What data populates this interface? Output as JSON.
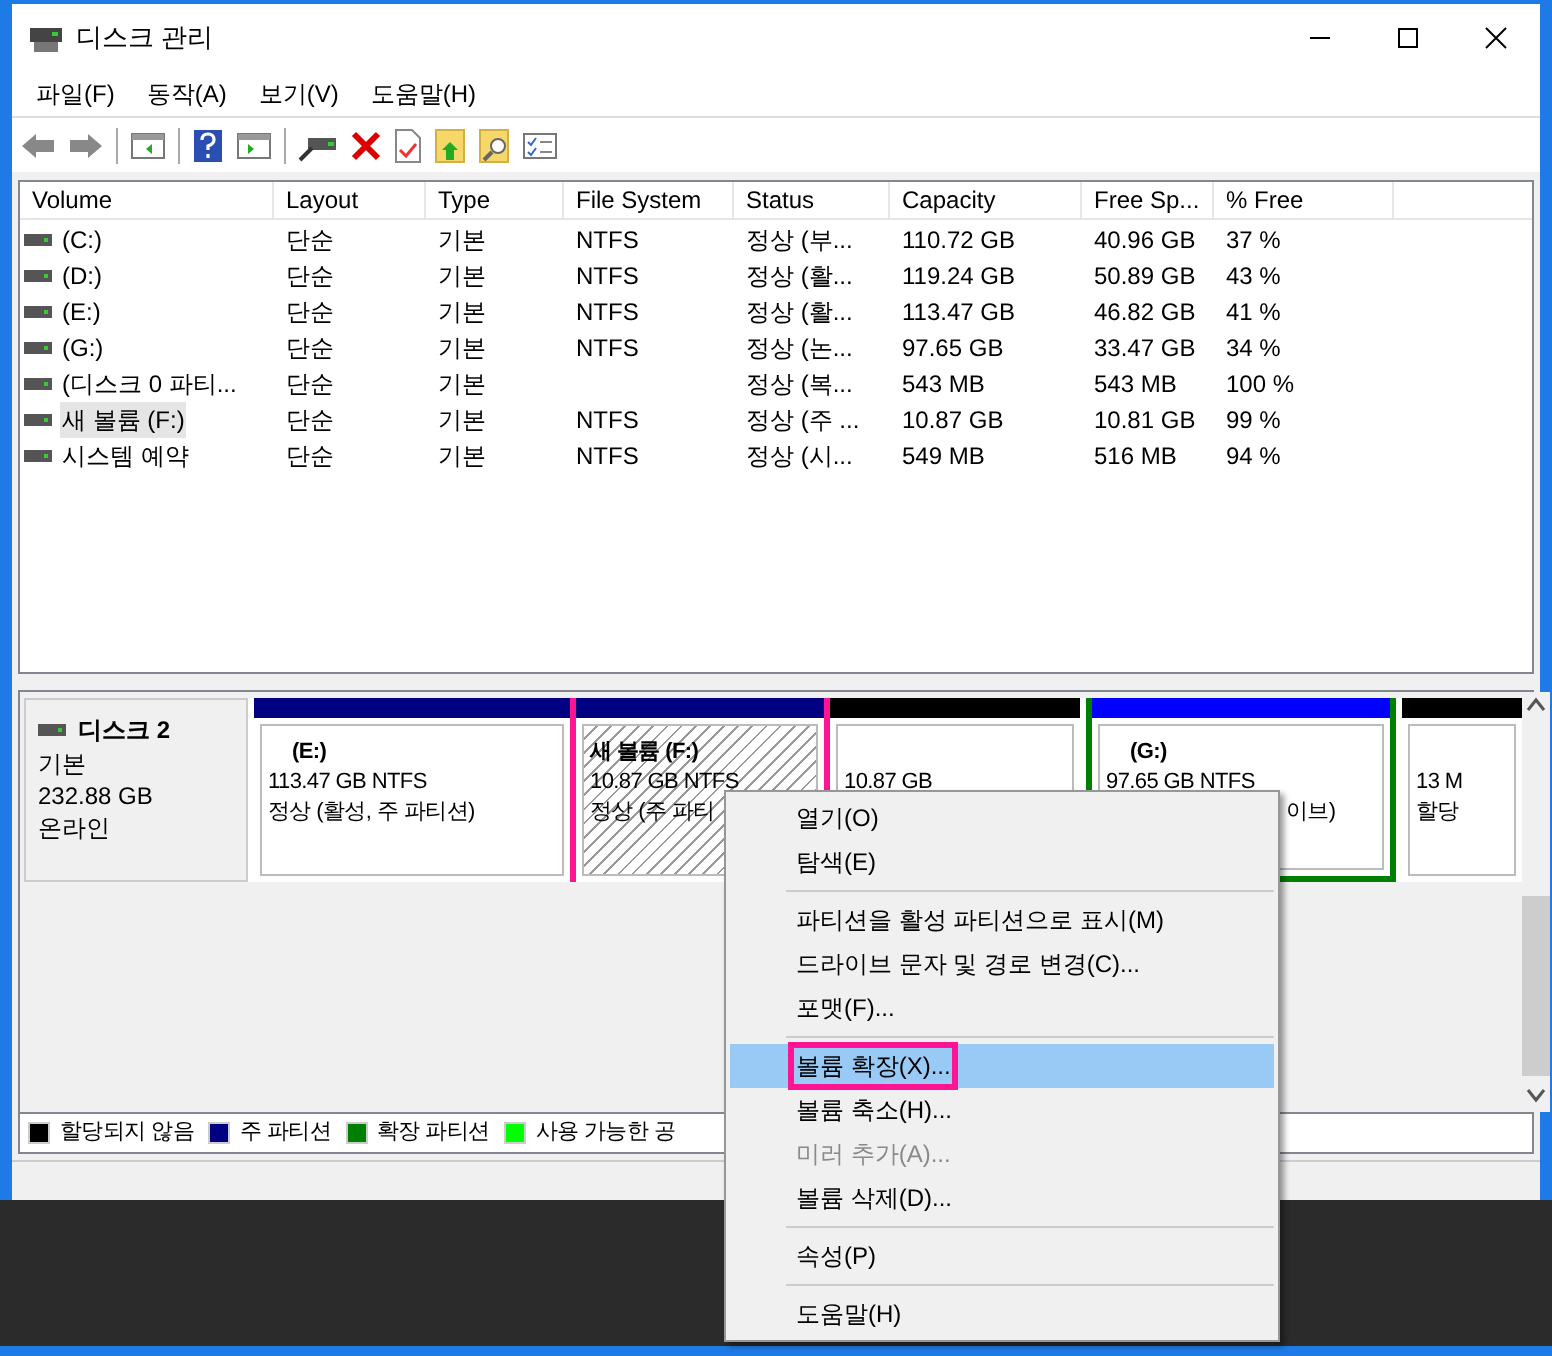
{
  "window": {
    "title": "디스크 관리"
  },
  "menu": [
    "파일(F)",
    "동작(A)",
    "보기(V)",
    "도움말(H)"
  ],
  "table": {
    "columns": [
      "Volume",
      "Layout",
      "Type",
      "File System",
      "Status",
      "Capacity",
      "Free Sp...",
      "% Free"
    ],
    "rows": [
      {
        "cells": [
          "(C:)",
          "단순",
          "기본",
          "NTFS",
          "정상 (부...",
          "110.72 GB",
          "40.96 GB",
          "37 %"
        ],
        "selected": false
      },
      {
        "cells": [
          "(D:)",
          "단순",
          "기본",
          "NTFS",
          "정상 (활...",
          "119.24 GB",
          "50.89 GB",
          "43 %"
        ],
        "selected": false
      },
      {
        "cells": [
          "(E:)",
          "단순",
          "기본",
          "NTFS",
          "정상 (활...",
          "113.47 GB",
          "46.82 GB",
          "41 %"
        ],
        "selected": false
      },
      {
        "cells": [
          "(G:)",
          "단순",
          "기본",
          "NTFS",
          "정상 (논...",
          "97.65 GB",
          "33.47 GB",
          "34 %"
        ],
        "selected": false
      },
      {
        "cells": [
          "(디스크 0 파티...",
          "단순",
          "기본",
          "",
          "정상 (복...",
          "543 MB",
          "543 MB",
          "100 %"
        ],
        "selected": false
      },
      {
        "cells": [
          "새 볼륨 (F:)",
          "단순",
          "기본",
          "NTFS",
          "정상 (주 ...",
          "10.87 GB",
          "10.81 GB",
          "99 %"
        ],
        "selected": true
      },
      {
        "cells": [
          "시스템 예약",
          "단순",
          "기본",
          "NTFS",
          "정상 (시...",
          "549 MB",
          "516 MB",
          "94 %"
        ],
        "selected": false
      }
    ]
  },
  "disk": {
    "name": "디스크 2",
    "type": "기본",
    "size": "232.88 GB",
    "state": "온라인",
    "partitions": [
      {
        "kind": "primary",
        "label": "(E:)",
        "size": "113.47 GB NTFS",
        "status": "정상 (활성, 주 파티션)",
        "selected": false,
        "highlighted": false
      },
      {
        "kind": "primary",
        "label": "새 볼륨  (F:)",
        "size": "10.87 GB NTFS",
        "status": "정상 (주 파티",
        "selected": true,
        "highlighted": true
      },
      {
        "kind": "unallocated",
        "size": "10.87 GB",
        "selected": false,
        "highlighted": false
      },
      {
        "kind": "logical",
        "label": "(G:)",
        "size": "97.65 GB NTFS",
        "status": "이브)",
        "selected": false,
        "highlighted": false
      },
      {
        "kind": "unallocated",
        "size": "13 M",
        "status": "할당",
        "selected": false,
        "highlighted": false
      }
    ]
  },
  "legend": [
    {
      "label": "할당되지 않음",
      "color": "#000000"
    },
    {
      "label": "주 파티션",
      "color": "#000080"
    },
    {
      "label": "확장 파티션",
      "color": "#008000"
    },
    {
      "label": "사용 가능한 공",
      "color": "#00ff00"
    }
  ],
  "context_menu": [
    {
      "kind": "item",
      "label": "열기(O)",
      "disabled": false,
      "selected": false,
      "highlighted": false
    },
    {
      "kind": "item",
      "label": "탐색(E)",
      "disabled": false,
      "selected": false,
      "highlighted": false
    },
    {
      "kind": "separator"
    },
    {
      "kind": "item",
      "label": "파티션을 활성 파티션으로 표시(M)",
      "disabled": false,
      "selected": false,
      "highlighted": false
    },
    {
      "kind": "item",
      "label": "드라이브 문자 및 경로 변경(C)...",
      "disabled": false,
      "selected": false,
      "highlighted": false
    },
    {
      "kind": "item",
      "label": "포맷(F)...",
      "disabled": false,
      "selected": false,
      "highlighted": false
    },
    {
      "kind": "separator"
    },
    {
      "kind": "item",
      "label": "볼륨 확장(X)...",
      "disabled": false,
      "selected": true,
      "highlighted": true
    },
    {
      "kind": "item",
      "label": "볼륨 축소(H)...",
      "disabled": false,
      "selected": false,
      "highlighted": false
    },
    {
      "kind": "item",
      "label": "미러 추가(A)...",
      "disabled": true,
      "selected": false,
      "highlighted": false
    },
    {
      "kind": "item",
      "label": "볼륨 삭제(D)...",
      "disabled": false,
      "selected": false,
      "highlighted": false
    },
    {
      "kind": "separator"
    },
    {
      "kind": "item",
      "label": "속성(P)",
      "disabled": false,
      "selected": false,
      "highlighted": false
    },
    {
      "kind": "separator"
    },
    {
      "kind": "item",
      "label": "도움말(H)",
      "disabled": false,
      "selected": false,
      "highlighted": false
    }
  ]
}
